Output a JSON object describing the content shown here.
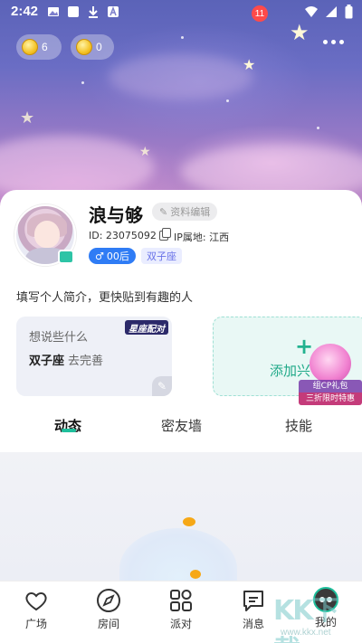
{
  "status_bar": {
    "time": "2:42"
  },
  "currency": {
    "stars": "6",
    "coins": "0"
  },
  "profile": {
    "name": "浪与够",
    "edit_label": "资料编辑",
    "id_text": "ID: 23075092",
    "ip_text": "IP属地: 江西",
    "age_tag": "00后",
    "zodiac_tag": "双子座",
    "bio_placeholder": "填写个人简介，更快贴到有趣的人"
  },
  "cards": {
    "left_question": "想说些什么",
    "left_zodiac": "双子座",
    "left_action": "去完善",
    "left_badge": "星座配对",
    "right_plus": "+",
    "right_label": "添加兴",
    "gift_caption_1": "组CP礼包",
    "gift_caption_2": "三折限时特惠"
  },
  "tabs": [
    "动态",
    "密友墙",
    "技能"
  ],
  "bottom_nav": {
    "items": [
      "广场",
      "房间",
      "派对",
      "消息",
      "我的"
    ],
    "messages_badge": "11"
  },
  "watermark": {
    "text": "KK下载",
    "url": "www.kkx.net"
  },
  "colors": {
    "accent": "#1fbf9c",
    "age_tag": "#2f7cf5",
    "badge": "#ff4a4a"
  }
}
